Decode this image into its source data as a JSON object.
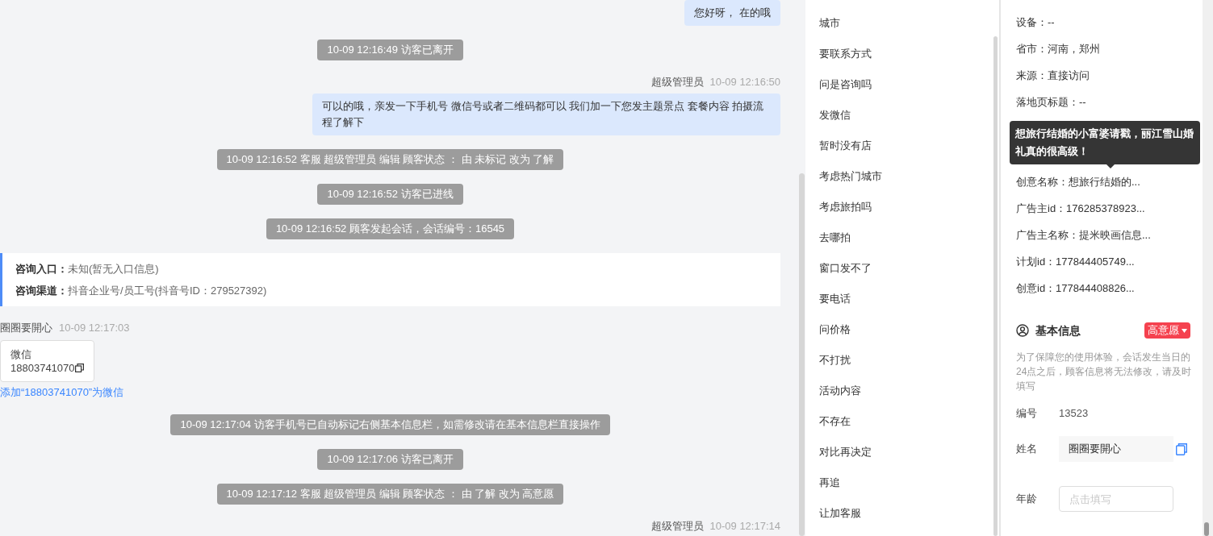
{
  "chat": {
    "messages": [
      {
        "kind": "agent",
        "text": "您好呀， 在的哦"
      },
      {
        "kind": "system",
        "text": "10-09 12:16:49 访客已离开"
      },
      {
        "kind": "agent",
        "sender": "超级管理员",
        "time": "10-09 12:16:50",
        "text": "可以的哦，亲发一下手机号 微信号或者二维码都可以 我们加一下您发主题景点 套餐内容 拍摄流程了解下"
      },
      {
        "kind": "system",
        "text": "10-09 12:16:52 客服 超级管理员 编辑 顾客状态 ： 由 未标记 改为 了解"
      },
      {
        "kind": "system",
        "text": "10-09 12:16:52 访客已进线"
      },
      {
        "kind": "system",
        "text": "10-09 12:16:52 顾客发起会话，会话编号：16545"
      },
      {
        "kind": "info",
        "rows": [
          {
            "label": "咨询入口：",
            "value": "未知(暂无入口信息)"
          },
          {
            "label": "咨询渠道：",
            "value": "抖音企业号/员工号(抖音号ID：279527392)"
          }
        ]
      },
      {
        "kind": "visitor",
        "sender": "圈圈要開心",
        "time": "10-09 12:17:03",
        "card_title": "微信",
        "card_value": "18803741070",
        "link": "添加“18803741070”为微信"
      },
      {
        "kind": "system",
        "text": "10-09 12:17:04 访客手机号已自动标记右侧基本信息栏，如需修改请在基本信息栏直接操作"
      },
      {
        "kind": "system",
        "text": "10-09 12:17:06 访客已离开"
      },
      {
        "kind": "system",
        "text": "10-09 12:17:12 客服 超级管理员 编辑 顾客状态 ： 由 了解 改为 高意愿"
      },
      {
        "kind": "header",
        "sender": "超级管理员",
        "time": "10-09 12:17:14"
      }
    ]
  },
  "tags": [
    "城市",
    "要联系方式",
    "问是咨询吗",
    "发微信",
    "暂时没有店",
    "考虑热门城市",
    "考虑旅拍吗",
    "去哪拍",
    "窗口发不了",
    "要电话",
    "问价格",
    "不打扰",
    "活动内容",
    "不存在",
    "对比再决定",
    "再追",
    "让加客服"
  ],
  "visit_info": {
    "rows_top": [
      "设备：--",
      "省市：河南，郑州",
      "来源：直接访问",
      "落地页标题：--"
    ],
    "tooltip": "想旅行结婚的小富婆请戳，丽江雪山婚礼真的很高级！",
    "rows_bottom": [
      "创意名称：想旅行结婚的...",
      "广告主id：176285378923...",
      "广告主名称：提米映画信息...",
      "计划id：177844405749...",
      "创意id：177844408826..."
    ]
  },
  "basic_info": {
    "title": "基本信息",
    "intent": "高意愿",
    "note": "为了保障您的使用体验，会话发生当日的24点之后，顾客信息将无法修改，请及时填写",
    "fields": [
      {
        "kind": "text",
        "label": "编号",
        "value": "13523"
      },
      {
        "kind": "filled",
        "label": "姓名",
        "value": "圈圈要開心"
      },
      {
        "kind": "input",
        "label": "年龄",
        "placeholder": "点击填写"
      }
    ]
  }
}
